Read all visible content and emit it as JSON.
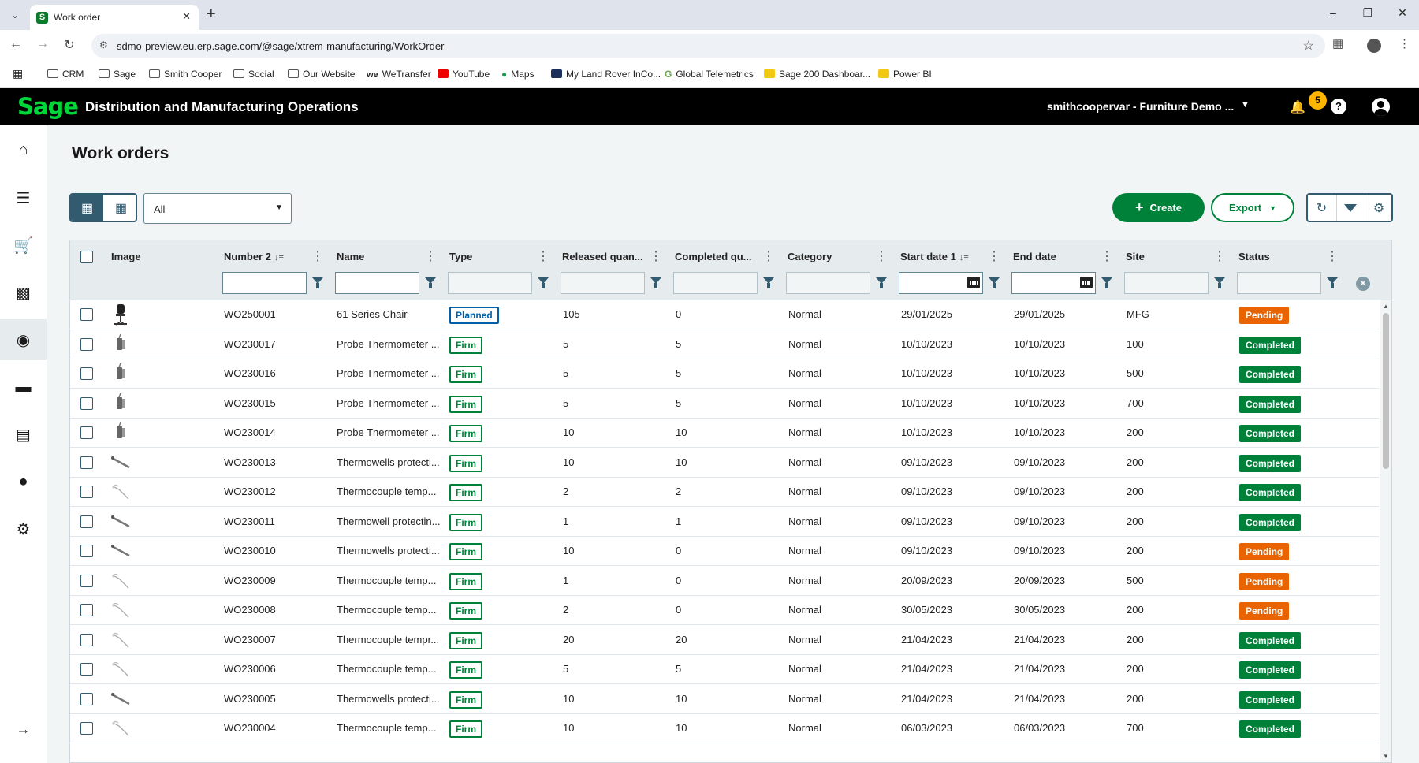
{
  "browser": {
    "tab_title": "Work order",
    "url": "sdmo-preview.eu.erp.sage.com/@sage/xtrem-manufacturing/WorkOrder",
    "bookmarks": [
      {
        "label": "CRM",
        "icon": "folder-icon"
      },
      {
        "label": "Sage",
        "icon": "folder-icon"
      },
      {
        "label": "Smith Cooper",
        "icon": "folder-icon"
      },
      {
        "label": "Social",
        "icon": "folder-icon"
      },
      {
        "label": "Our Website",
        "icon": "folder-icon"
      },
      {
        "label": "WeTransfer",
        "icon": "wetransfer-icon"
      },
      {
        "label": "YouTube",
        "icon": "youtube-icon"
      },
      {
        "label": "Maps",
        "icon": "maps-pin-icon"
      },
      {
        "label": "My Land Rover InCo...",
        "icon": "landrover-icon"
      },
      {
        "label": "Global Telemetrics",
        "icon": "globe-g-icon"
      },
      {
        "label": "Sage 200 Dashboar...",
        "icon": "powerbi-icon"
      },
      {
        "label": "Power BI",
        "icon": "powerbi-icon"
      }
    ]
  },
  "app": {
    "logo_text": "Sage",
    "title": "Distribution and Manufacturing Operations",
    "tenant": "smithcoopervar - Furniture Demo ...",
    "notification_count": "5",
    "help_label": "?"
  },
  "page": {
    "title": "Work orders",
    "view_filter": "All",
    "create_label": "Create",
    "export_label": "Export"
  },
  "grid": {
    "columns": [
      {
        "label": "Image"
      },
      {
        "label": "Number 2"
      },
      {
        "label": "Name"
      },
      {
        "label": "Type"
      },
      {
        "label": "Released quan..."
      },
      {
        "label": "Completed qu..."
      },
      {
        "label": "Category"
      },
      {
        "label": "Start date 1"
      },
      {
        "label": "End date"
      },
      {
        "label": "Site"
      },
      {
        "label": "Status"
      }
    ],
    "rows": [
      {
        "number": "WO250001",
        "name": "61 Series Chair",
        "type": "Planned",
        "released": "105",
        "completed": "0",
        "category": "Normal",
        "start": "29/01/2025",
        "end": "29/01/2025",
        "site": "MFG",
        "status": "Pending",
        "image": "chair"
      },
      {
        "number": "WO230017",
        "name": "Probe Thermometer ...",
        "type": "Firm",
        "released": "5",
        "completed": "5",
        "category": "Normal",
        "start": "10/10/2023",
        "end": "10/10/2023",
        "site": "100",
        "status": "Completed",
        "image": "probe"
      },
      {
        "number": "WO230016",
        "name": "Probe Thermometer ...",
        "type": "Firm",
        "released": "5",
        "completed": "5",
        "category": "Normal",
        "start": "10/10/2023",
        "end": "10/10/2023",
        "site": "500",
        "status": "Completed",
        "image": "probe"
      },
      {
        "number": "WO230015",
        "name": "Probe Thermometer ...",
        "type": "Firm",
        "released": "5",
        "completed": "5",
        "category": "Normal",
        "start": "10/10/2023",
        "end": "10/10/2023",
        "site": "700",
        "status": "Completed",
        "image": "probe"
      },
      {
        "number": "WO230014",
        "name": "Probe Thermometer ...",
        "type": "Firm",
        "released": "10",
        "completed": "10",
        "category": "Normal",
        "start": "10/10/2023",
        "end": "10/10/2023",
        "site": "200",
        "status": "Completed",
        "image": "probe"
      },
      {
        "number": "WO230013",
        "name": "Thermowells protecti...",
        "type": "Firm",
        "released": "10",
        "completed": "10",
        "category": "Normal",
        "start": "09/10/2023",
        "end": "09/10/2023",
        "site": "200",
        "status": "Completed",
        "image": "rod"
      },
      {
        "number": "WO230012",
        "name": "Thermocouple temp...",
        "type": "Firm",
        "released": "2",
        "completed": "2",
        "category": "Normal",
        "start": "09/10/2023",
        "end": "09/10/2023",
        "site": "200",
        "status": "Completed",
        "image": "wire"
      },
      {
        "number": "WO230011",
        "name": "Thermowell protectin...",
        "type": "Firm",
        "released": "1",
        "completed": "1",
        "category": "Normal",
        "start": "09/10/2023",
        "end": "09/10/2023",
        "site": "200",
        "status": "Completed",
        "image": "rod"
      },
      {
        "number": "WO230010",
        "name": "Thermowells protecti...",
        "type": "Firm",
        "released": "10",
        "completed": "0",
        "category": "Normal",
        "start": "09/10/2023",
        "end": "09/10/2023",
        "site": "200",
        "status": "Pending",
        "image": "rod"
      },
      {
        "number": "WO230009",
        "name": "Thermocouple temp...",
        "type": "Firm",
        "released": "1",
        "completed": "0",
        "category": "Normal",
        "start": "20/09/2023",
        "end": "20/09/2023",
        "site": "500",
        "status": "Pending",
        "image": "wire"
      },
      {
        "number": "WO230008",
        "name": "Thermocouple temp...",
        "type": "Firm",
        "released": "2",
        "completed": "0",
        "category": "Normal",
        "start": "30/05/2023",
        "end": "30/05/2023",
        "site": "200",
        "status": "Pending",
        "image": "wire"
      },
      {
        "number": "WO230007",
        "name": "Thermocouple tempr...",
        "type": "Firm",
        "released": "20",
        "completed": "20",
        "category": "Normal",
        "start": "21/04/2023",
        "end": "21/04/2023",
        "site": "200",
        "status": "Completed",
        "image": "wire"
      },
      {
        "number": "WO230006",
        "name": "Thermocouple temp...",
        "type": "Firm",
        "released": "5",
        "completed": "5",
        "category": "Normal",
        "start": "21/04/2023",
        "end": "21/04/2023",
        "site": "200",
        "status": "Completed",
        "image": "wire"
      },
      {
        "number": "WO230005",
        "name": "Thermowells protecti...",
        "type": "Firm",
        "released": "10",
        "completed": "10",
        "category": "Normal",
        "start": "21/04/2023",
        "end": "21/04/2023",
        "site": "200",
        "status": "Completed",
        "image": "rod"
      },
      {
        "number": "WO230004",
        "name": "Thermocouple temp...",
        "type": "Firm",
        "released": "10",
        "completed": "10",
        "category": "Normal",
        "start": "06/03/2023",
        "end": "06/03/2023",
        "site": "700",
        "status": "Completed",
        "image": "wire"
      }
    ]
  },
  "colors": {
    "brand_green": "#00813a",
    "pending_orange": "#e96400",
    "planned_blue": "#0060a7",
    "sage_logo_green": "#00d639"
  }
}
